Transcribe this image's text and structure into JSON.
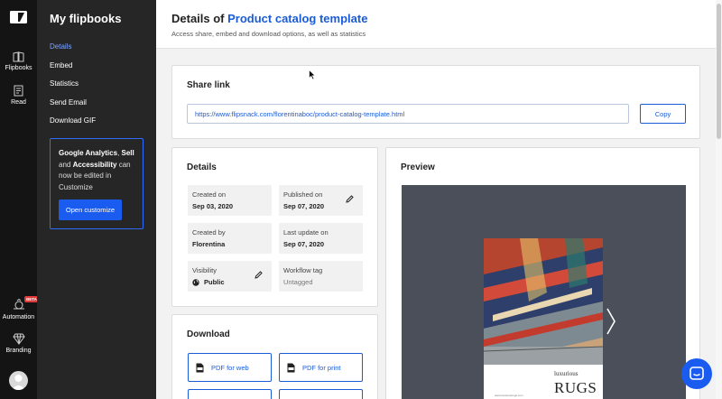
{
  "rail": {
    "items": [
      {
        "label": "Flipbooks",
        "icon": "flipbooks-icon"
      },
      {
        "label": "Read",
        "icon": "read-icon"
      },
      {
        "label": "Automation",
        "icon": "automation-icon",
        "badge": "BETA"
      },
      {
        "label": "Branding",
        "icon": "branding-icon"
      }
    ]
  },
  "sidebar": {
    "title": "My flipbooks",
    "links": [
      "Details",
      "Embed",
      "Statistics",
      "Send Email",
      "Download GIF"
    ],
    "active": "Details",
    "promo": {
      "part1": "Google Analytics",
      "sep1": ", ",
      "part2": "Sell",
      "sep2": " and ",
      "part3": "Accessibility",
      "rest": " can now be edited in Customize",
      "button": "Open customize"
    }
  },
  "header": {
    "title_prefix": "Details of ",
    "title_name": "Product catalog template",
    "subtitle": "Access share, embed and download options, as well as statistics"
  },
  "share": {
    "heading": "Share link",
    "url": "https://www.flipsnack.com/florentinaboc/product-catalog-template.html",
    "copy_label": "Copy"
  },
  "details": {
    "heading": "Details",
    "tiles": [
      {
        "label": "Created on",
        "value": "Sep 03, 2020"
      },
      {
        "label": "Published on",
        "value": "Sep 07, 2020"
      },
      {
        "label": "Created by",
        "value": "Florentina"
      },
      {
        "label": "Last update on",
        "value": "Sep 07, 2020"
      },
      {
        "label": "Visibility",
        "value": "Public"
      },
      {
        "label": "Workflow tag",
        "value": "Untagged"
      }
    ]
  },
  "download": {
    "heading": "Download",
    "buttons": [
      "PDF for web",
      "PDF for print"
    ]
  },
  "preview": {
    "heading": "Preview",
    "cover_brand_small": "luxurious",
    "cover_brand_large": "RUGS",
    "cover_footer": "www.luxuriousrugs.com"
  },
  "colors": {
    "accent": "#1a5cd8",
    "rail_bg": "#141414",
    "sidebar_bg": "#262626",
    "preview_bg": "#4a4f5a"
  }
}
